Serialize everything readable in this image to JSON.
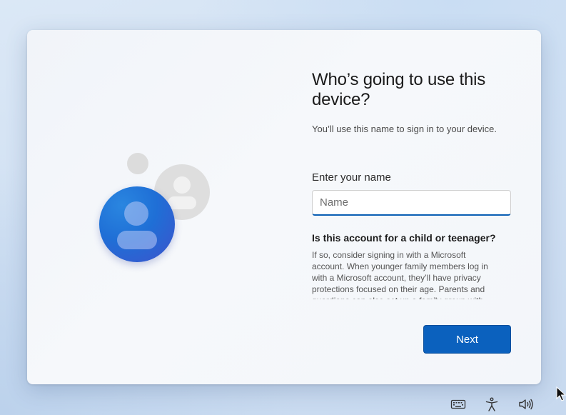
{
  "dialog": {
    "title": "Who’s going to use this device?",
    "subtitle": "You’ll use this name to sign in to your device.",
    "name_label": "Enter your name",
    "name_placeholder": "Name",
    "name_value": "",
    "child_heading": "Is this account for a child or teenager?",
    "child_body": "If so, consider signing in with a Microsoft account. When younger family members log in with a Microsoft account, they’ll have privacy protections focused on their age. Parents and guardians can also set up a family group with",
    "next_label": "Next"
  },
  "tray": {
    "icons": [
      "keyboard-icon",
      "accessibility-icon",
      "volume-icon"
    ]
  },
  "colors": {
    "accent": "#0b61be",
    "avatar_blue": "#1f6fd6"
  }
}
